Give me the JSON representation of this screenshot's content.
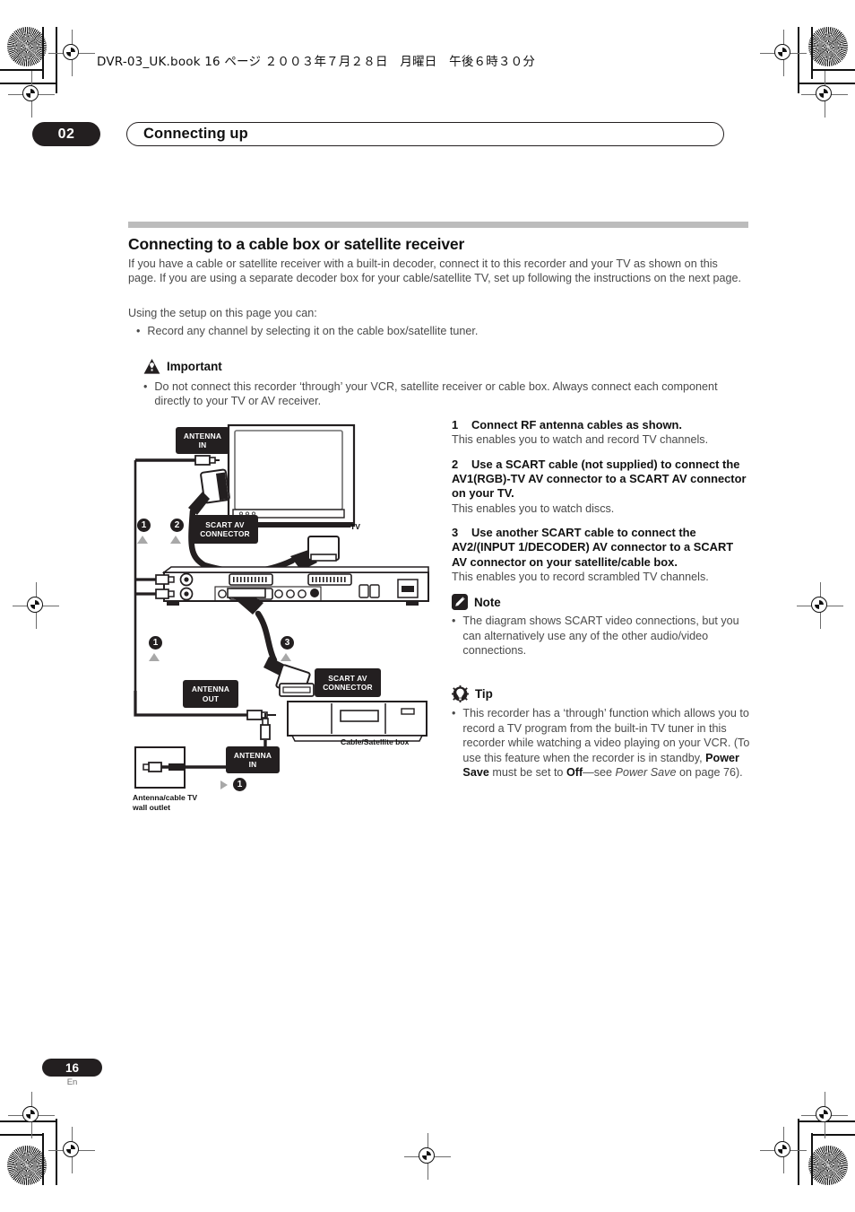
{
  "header": {
    "book_line": "DVR-03_UK.book 16 ページ ２００３年７月２８日　月曜日　午後６時３０分"
  },
  "chapter": {
    "number": "02",
    "title": "Connecting up"
  },
  "section": {
    "heading": "Connecting to a cable box or satellite receiver",
    "intro_paragraph": "If you have a cable or satellite receiver with a built-in decoder, connect it to this recorder and your TV as shown on this page. If you are using a separate decoder box for your cable/satellite TV, set up following the instructions on the next page.",
    "intro_lead": "Using the setup on this page you can:",
    "intro_bullet": "Record any channel by selecting it on the cable box/satellite tuner."
  },
  "important": {
    "icon": "warning-triangle-icon",
    "title": "Important",
    "bullet": "Do not connect this recorder ‘through’ your VCR, satellite receiver or cable box. Always connect each component directly to your TV or AV receiver."
  },
  "steps": [
    {
      "number": "1",
      "heading": "Connect RF antenna cables as shown.",
      "description": "This enables you to watch and record TV channels."
    },
    {
      "number": "2",
      "heading": "Use a SCART cable (not supplied) to connect the AV1(RGB)-TV AV connector to a SCART AV connector on your TV.",
      "description": "This enables you to watch discs."
    },
    {
      "number": "3",
      "heading": "Use another SCART cable to connect the AV2/(INPUT 1/DECODER) AV connector to a SCART AV connector on your satellite/cable box.",
      "description": "This enables you to record scrambled TV channels."
    }
  ],
  "note": {
    "icon": "pencil-icon",
    "title": "Note",
    "bullet": "The diagram shows SCART video connections, but you can alternatively use any of the other audio/video connections."
  },
  "tip": {
    "icon": "gear-bulb-icon",
    "title": "Tip",
    "bullet_part1": "This recorder has a ‘through’ function which allows you to record a TV program from the built-in TV tuner in this recorder while watching a video playing on your VCR. (To use this feature when the recorder is in standby, ",
    "bold1": "Power Save",
    "bullet_part2": " must be set to ",
    "bold2": "Off",
    "bullet_part3": "—see ",
    "italic1": "Power Save",
    "bullet_part4": " on page 76)."
  },
  "diagram": {
    "labels": {
      "antenna_in_top": "ANTENNA\nIN",
      "scart_av_connector_top": "SCART AV\nCONNECTOR",
      "scart_av_connector_bottom": "SCART AV\nCONNECTOR",
      "antenna_out": "ANTENNA\nOUT",
      "antenna_in_bottom": "ANTENNA\nIN",
      "tv": "TV",
      "cable_sat_box": "Cable/Satellite box",
      "wall_outlet": "Antenna/cable TV\nwall outlet"
    },
    "markers": [
      "1",
      "2",
      "1",
      "3",
      "1"
    ]
  },
  "footer": {
    "page_number": "16",
    "language": "En"
  },
  "colors": {
    "ink": "#231f20",
    "rule": "#bcbcbc",
    "body_text": "#4a4a4a"
  }
}
